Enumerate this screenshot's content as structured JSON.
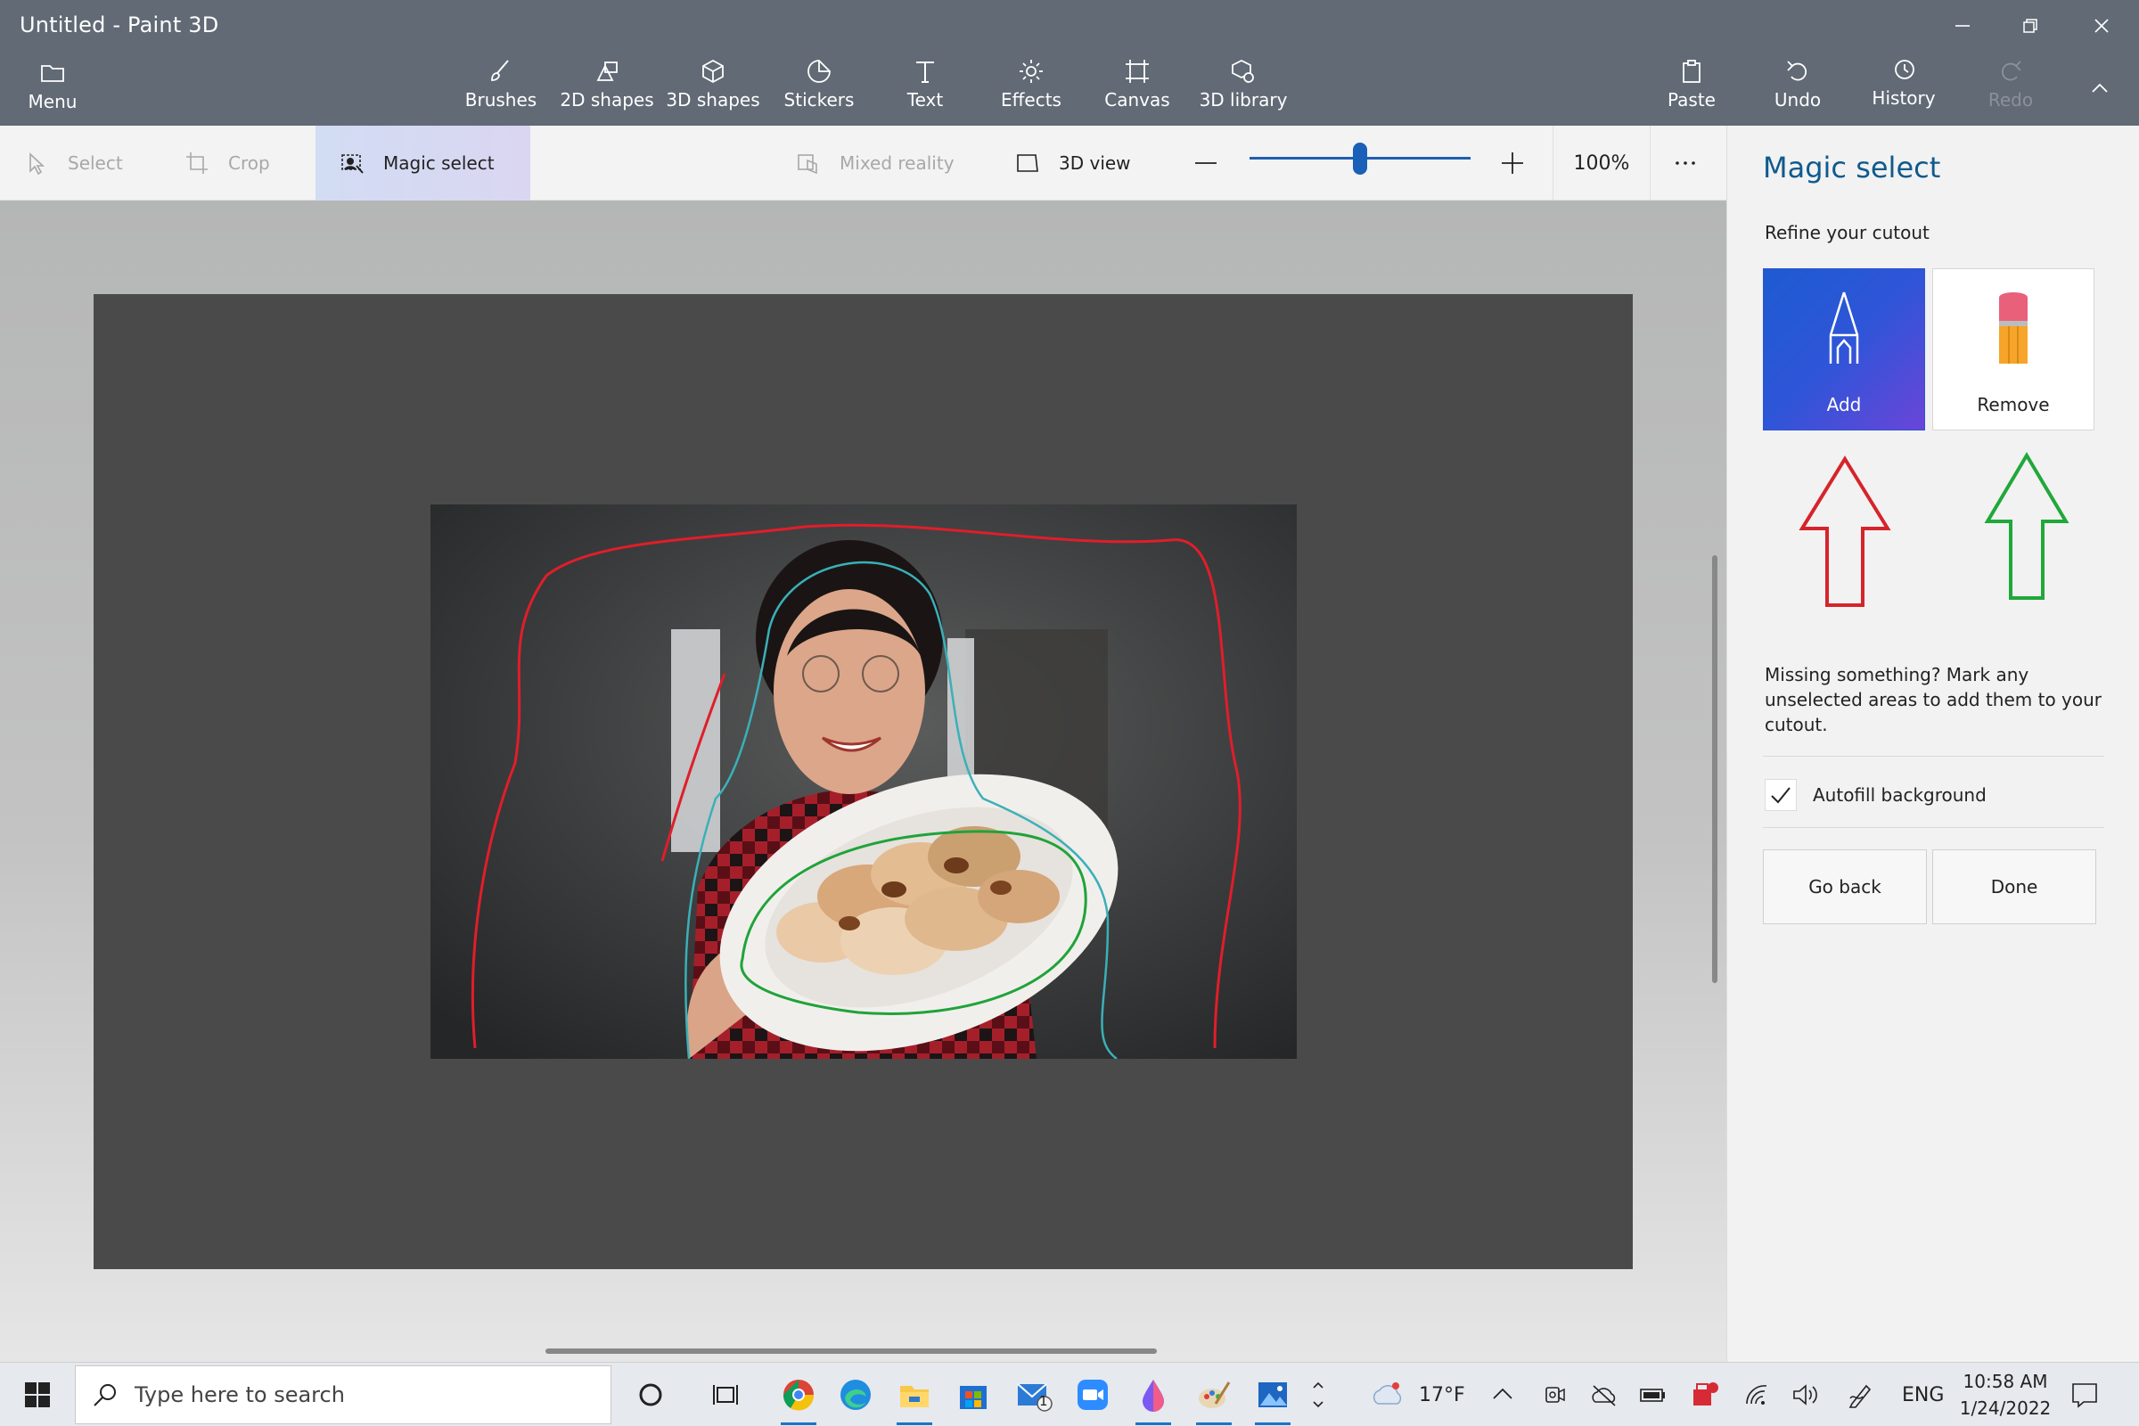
{
  "window": {
    "title": "Untitled - Paint 3D"
  },
  "ribbon": {
    "menu_label": "Menu",
    "tools": [
      {
        "label": "Brushes"
      },
      {
        "label": "2D shapes"
      },
      {
        "label": "3D shapes"
      },
      {
        "label": "Stickers"
      },
      {
        "label": "Text"
      },
      {
        "label": "Effects"
      },
      {
        "label": "Canvas"
      },
      {
        "label": "3D library"
      }
    ],
    "paste_label": "Paste",
    "undo_label": "Undo",
    "history_label": "History",
    "redo_label": "Redo"
  },
  "toolbar": {
    "select_label": "Select",
    "crop_label": "Crop",
    "magic_select_label": "Magic select",
    "mixed_reality_label": "Mixed reality",
    "view3d_label": "3D view",
    "zoom_value": "100%",
    "zoom_level": 0.5
  },
  "panel": {
    "title": "Magic select",
    "subtitle": "Refine your cutout",
    "add_label": "Add",
    "remove_label": "Remove",
    "hint": "Missing something? Mark any unselected areas to add them to your cutout.",
    "autofill_label": "Autofill background",
    "autofill_checked": true,
    "go_back_label": "Go back",
    "done_label": "Done"
  },
  "annotations": {
    "left_arrow_color": "#d6242b",
    "right_arrow_color": "#20a83a"
  },
  "taskbar": {
    "search_placeholder": "Type here to search",
    "weather": "17°F",
    "language": "ENG",
    "time": "10:58 AM",
    "date": "1/24/2022",
    "mail_badge": "1"
  }
}
